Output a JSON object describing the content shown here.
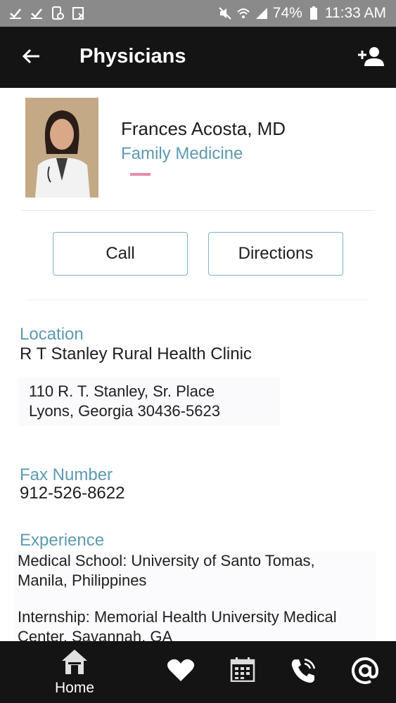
{
  "status_bar": {
    "battery": "74%",
    "time": "11:33 AM"
  },
  "app_bar": {
    "title": "Physicians",
    "back_icon": "arrow-left-icon",
    "action_icon": "add-contact-icon"
  },
  "profile": {
    "name": "Frances Acosta, MD",
    "specialty": "Family Medicine"
  },
  "actions": {
    "call_label": "Call",
    "directions_label": "Directions"
  },
  "location": {
    "label": "Location",
    "clinic": "R T Stanley Rural Health Clinic",
    "address_line1": "110 R. T. Stanley, Sr. Place",
    "address_line2": "Lyons, Georgia 30436-5623"
  },
  "fax": {
    "label": "Fax Number",
    "value": "912-526-8622"
  },
  "experience": {
    "label": "Experience",
    "line1": "Medical School: University of Santo Tomas,",
    "line2": "Manila, Philippines",
    "line3": "Internship: Memorial Health University Medical",
    "line4": "Center, Savannah, GA"
  },
  "bottom_nav": {
    "home_label": "Home"
  },
  "colors": {
    "accent": "#5d9ab0",
    "button_border": "#7fb4c5",
    "pink": "#e88bab",
    "bar": "#141414"
  }
}
